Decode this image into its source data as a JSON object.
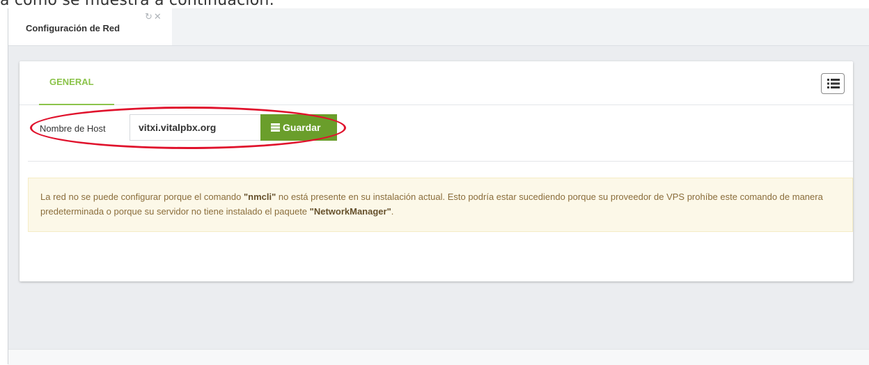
{
  "caption": "a como se muestra a continuación:",
  "window": {
    "tab_label": "Configuración de Red",
    "refresh_icon": "refresh-icon",
    "close_icon": "close-icon"
  },
  "panel": {
    "tab_general": "GENERAL",
    "menu_icon": "list-icon"
  },
  "host": {
    "label": "Nombre de Host",
    "value": "vitxi.vitalpbx.org",
    "save_label": "Guardar",
    "save_icon": "server-icon"
  },
  "alert": {
    "part1": "La red no se puede configurar porque el comando ",
    "cmd": "\"nmcli\"",
    "part2": " no está presente en su instalación actual. Esto podría estar sucediendo porque su proveedor de VPS prohíbe este comando de manera predeterminada o porque su servidor no tiene instalado el paquete ",
    "pkg": "\"NetworkManager\"",
    "part3": "."
  },
  "colors": {
    "accent_green": "#8bc34a",
    "button_green": "#6a9e2b",
    "highlight_red": "#e0122c",
    "alert_bg": "#fcf8e8"
  }
}
